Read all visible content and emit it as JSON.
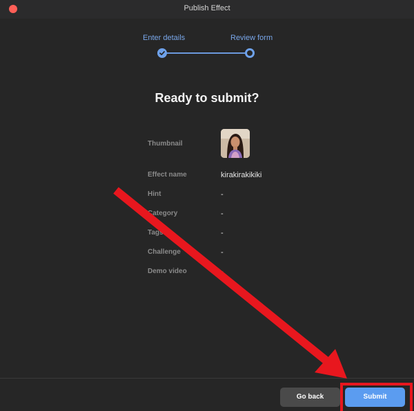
{
  "window": {
    "title": "Publish Effect"
  },
  "stepper": {
    "steps": [
      {
        "label": "Enter details",
        "state": "completed"
      },
      {
        "label": "Review form",
        "state": "current"
      }
    ]
  },
  "main": {
    "heading": "Ready to submit?",
    "fields": [
      {
        "label": "Thumbnail",
        "value": ""
      },
      {
        "label": "Effect name",
        "value": "kirakirakikiki"
      },
      {
        "label": "Hint",
        "value": "-"
      },
      {
        "label": "Category",
        "value": "-"
      },
      {
        "label": "Tags",
        "value": "-"
      },
      {
        "label": "Challenge",
        "value": "-"
      },
      {
        "label": "Demo video",
        "value": "-"
      }
    ]
  },
  "footer": {
    "go_back_label": "Go back",
    "submit_label": "Submit"
  },
  "colors": {
    "accent": "#5b9cf0",
    "annotation": "#e8171e",
    "close": "#ff5f57"
  },
  "icons": {
    "completed_step": "check-icon",
    "current_step": "ring-icon"
  }
}
